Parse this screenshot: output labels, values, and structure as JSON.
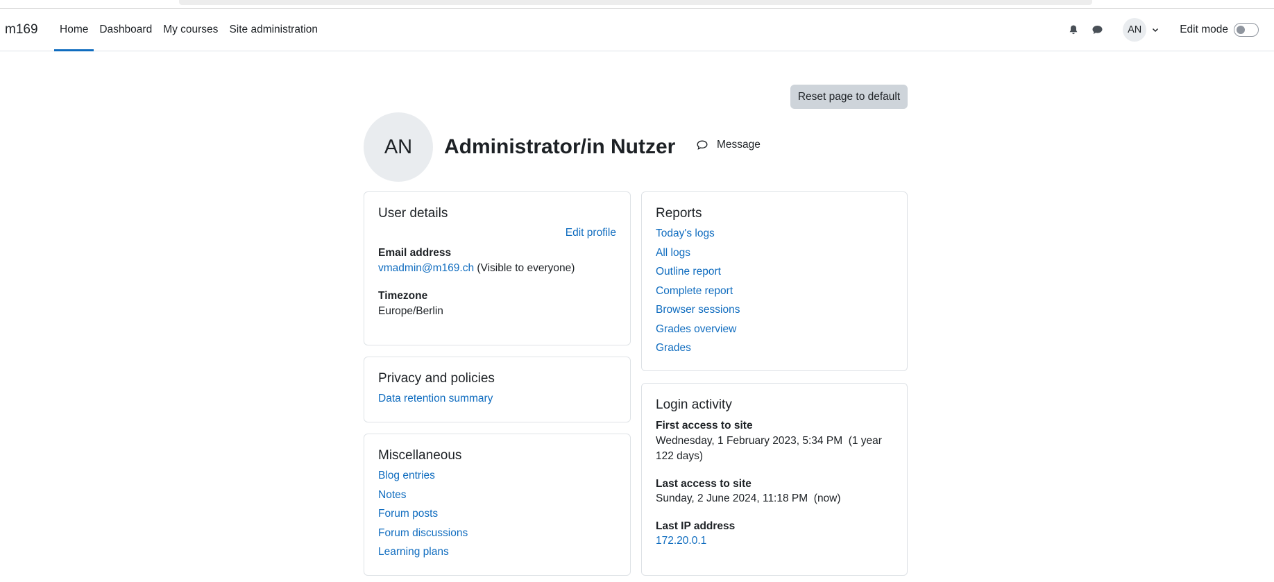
{
  "site": {
    "name": "m169"
  },
  "nav": {
    "items": [
      {
        "label": "Home",
        "active": true
      },
      {
        "label": "Dashboard",
        "active": false
      },
      {
        "label": "My courses",
        "active": false
      },
      {
        "label": "Site administration",
        "active": false
      }
    ],
    "user_initials": "AN",
    "edit_mode_label": "Edit mode",
    "edit_mode_on": false
  },
  "page": {
    "reset_label": "Reset page to default",
    "avatar_initials": "AN",
    "user_name": "Administrator/in Nutzer",
    "message_label": "Message"
  },
  "user_details": {
    "title": "User details",
    "edit_profile": "Edit profile",
    "email_label": "Email address",
    "email": "vmadmin@m169.ch",
    "email_visibility": "(Visible to everyone)",
    "timezone_label": "Timezone",
    "timezone": "Europe/Berlin"
  },
  "privacy": {
    "title": "Privacy and policies",
    "links": [
      "Data retention summary"
    ]
  },
  "misc": {
    "title": "Miscellaneous",
    "links": [
      "Blog entries",
      "Notes",
      "Forum posts",
      "Forum discussions",
      "Learning plans"
    ]
  },
  "reports": {
    "title": "Reports",
    "links": [
      "Today's logs",
      "All logs",
      "Outline report",
      "Complete report",
      "Browser sessions",
      "Grades overview",
      "Grades"
    ]
  },
  "login_activity": {
    "title": "Login activity",
    "first_access_label": "First access to site",
    "first_access_line1": "Wednesday, 1 February 2023, 5:34 PM  (1 year",
    "first_access_line2": "122 days)",
    "last_access_label": "Last access to site",
    "last_access": "Sunday, 2 June 2024, 11:18 PM  (now)",
    "last_ip_label": "Last IP address",
    "last_ip": "172.20.0.1"
  },
  "colors": {
    "link": "#0f6cbf",
    "active_nav": "#0f6cbf",
    "button_bg": "#ced4da"
  }
}
